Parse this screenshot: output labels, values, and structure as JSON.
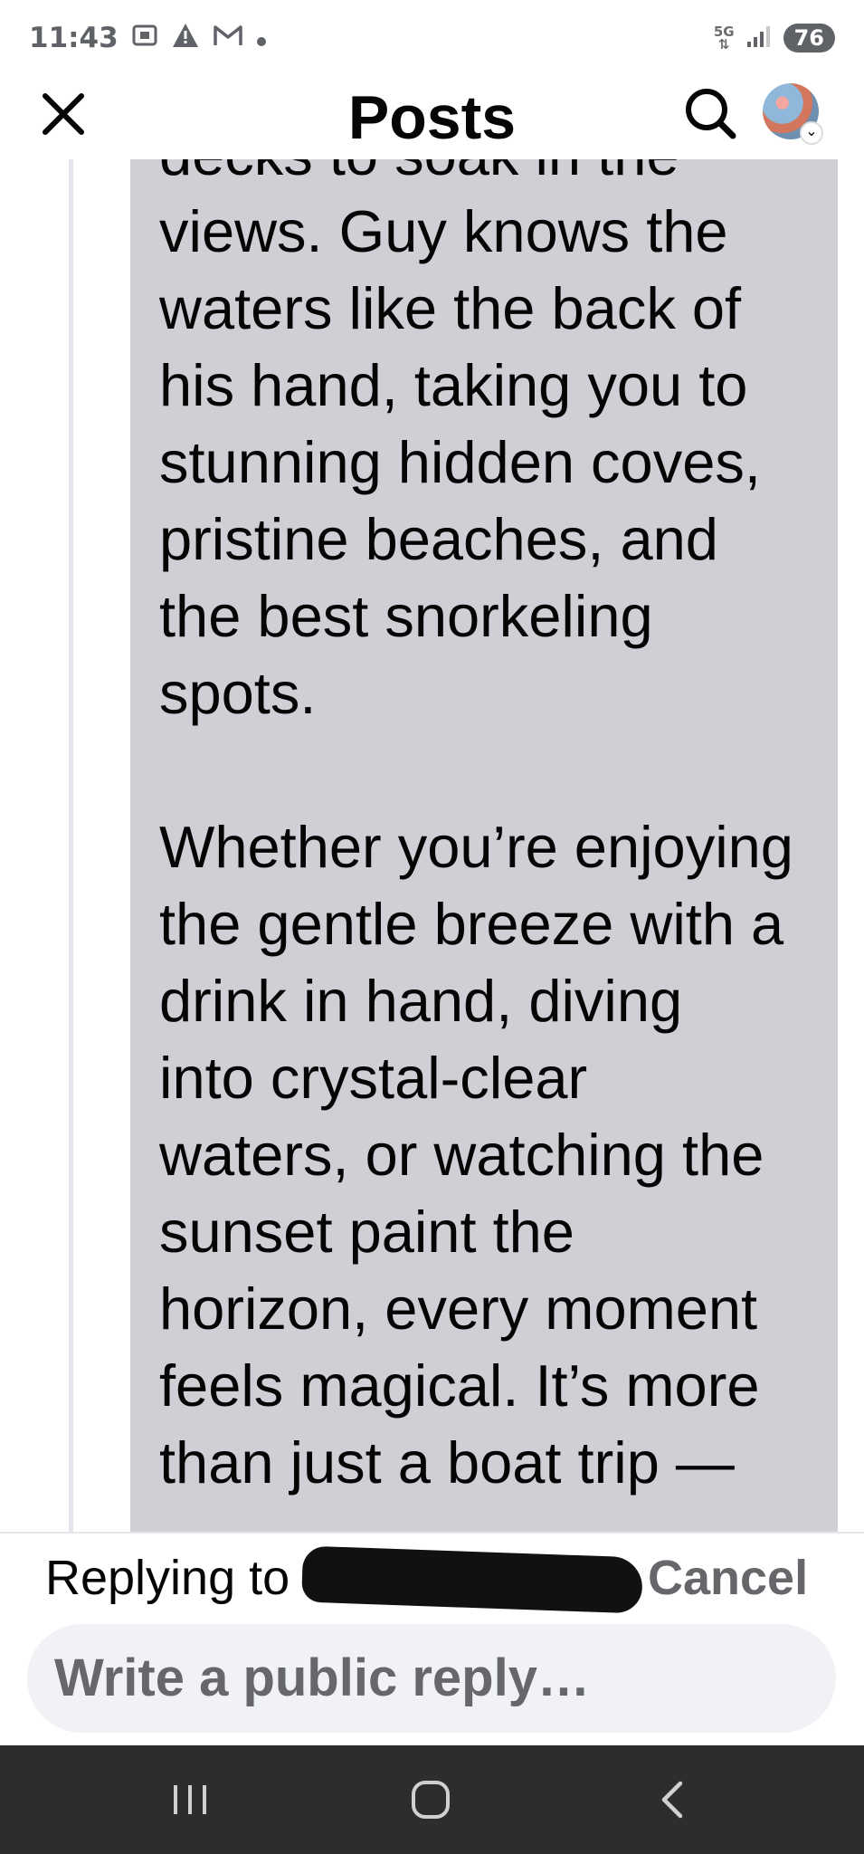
{
  "status_bar": {
    "time": "11:43",
    "network_label": "5G",
    "battery": "76"
  },
  "header": {
    "title": "Posts"
  },
  "comment": {
    "body": "decks to soak in the\nviews. Guy knows the\nwaters like the back of\nhis hand, taking you to\nstunning hidden coves,\npristine beaches, and\nthe best snorkeling\nspots.\n\nWhether you’re enjoying\nthe gentle breeze with a\ndrink in hand, diving\ninto crystal-clear\nwaters, or watching the\nsunset paint the\nhorizon, every moment\nfeels magical. It’s more\nthan just a boat trip —"
  },
  "reply_bar": {
    "replying_label": "Replying to",
    "cancel_label": "Cancel",
    "input_placeholder": "Write a public reply…"
  },
  "colors": {
    "bubble_background": "#ced0d5",
    "nav_bar": "#2d2d2f",
    "muted_text": "#65676b"
  },
  "icons": [
    "close-icon",
    "search-icon",
    "avatar",
    "recents-icon",
    "home-icon",
    "back-icon"
  ]
}
